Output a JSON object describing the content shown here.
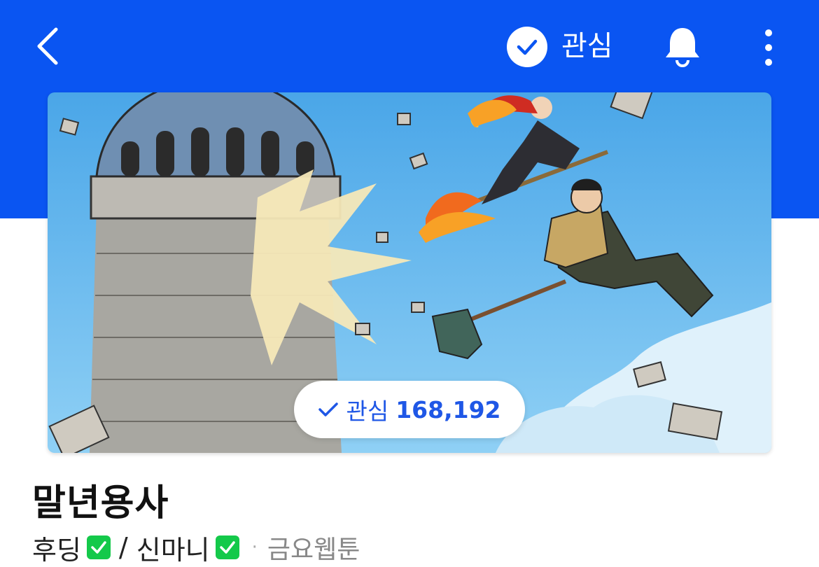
{
  "header": {
    "back_icon": "chevron-left-icon",
    "favorite_check_icon": "check-circle-icon",
    "favorite_label": "관심",
    "bell_icon": "bell-icon",
    "more_icon": "more-vertical-icon",
    "bar_color": "#0a55f2"
  },
  "cover": {
    "image": "webtoon-cover-art",
    "favorite_count_label": "관심",
    "favorite_count": "168,192"
  },
  "info": {
    "title": "말년용사",
    "author1": "후딩",
    "separator": "/",
    "author2": "신마니",
    "genre_separator": "·",
    "schedule": "금요웹툰",
    "badge_color": "#14c94a"
  }
}
